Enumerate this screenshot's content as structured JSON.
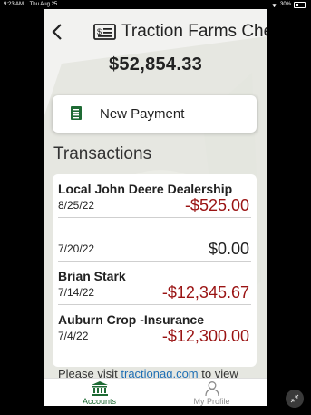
{
  "status_bar": {
    "time": "9:23 AM",
    "date": "Thu Aug 25",
    "battery": "30%"
  },
  "header": {
    "back_icon": "chevron-left-icon",
    "account_icon": "check-icon",
    "title": "Traction Farms Che"
  },
  "balance": "$52,854.33",
  "new_payment": {
    "icon": "document-icon",
    "label": "New Payment"
  },
  "transactions": {
    "title": "Transactions",
    "items": [
      {
        "name": "Local John Deere Dealership",
        "date": "8/25/22",
        "amount": "-$525.00",
        "negative": true
      },
      {
        "name": "",
        "date": "7/20/22",
        "amount": "$0.00",
        "negative": false
      },
      {
        "name": "Brian Stark",
        "date": "7/14/22",
        "amount": "-$12,345.67",
        "negative": true
      },
      {
        "name": "Auburn Crop -Insurance",
        "date": "7/4/22",
        "amount": "-$12,300.00",
        "negative": true
      }
    ]
  },
  "footer": {
    "prefix": "Please visit ",
    "link": "tractionag.com",
    "suffix": " to view"
  },
  "tabs": {
    "accounts": {
      "label": "Accounts",
      "icon": "bank-icon"
    },
    "profile": {
      "label": "My Profile",
      "icon": "person-icon"
    }
  },
  "colors": {
    "accent": "#1e6b34",
    "negative": "#9a1313",
    "link": "#1f6fb5"
  }
}
